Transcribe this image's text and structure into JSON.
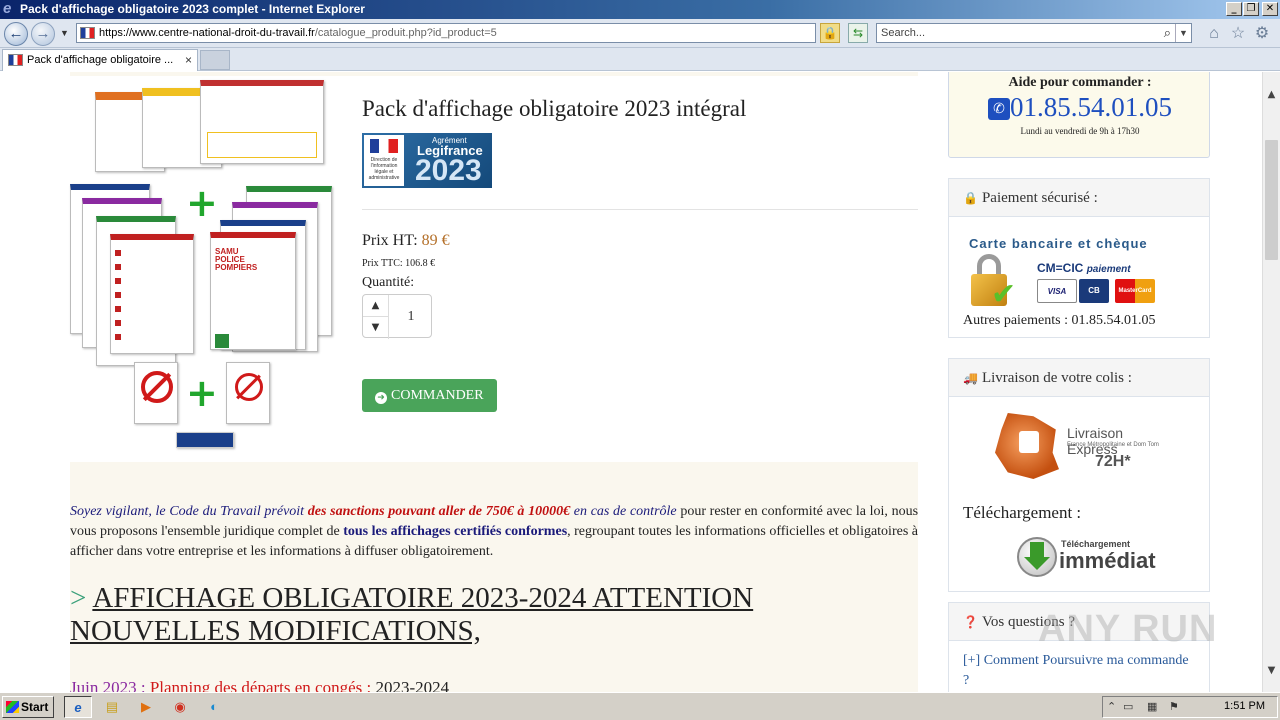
{
  "window": {
    "title": "Pack d'affichage obligatoire 2023 complet - Internet Explorer"
  },
  "address_bar": {
    "url_domain": "https://www.centre-national-droit-du-travail.fr",
    "url_path": "/catalogue_produit.php?id_product=5",
    "search_placeholder": "Search..."
  },
  "tab": {
    "label": "Pack d'affichage obligatoire ...",
    "close": "×"
  },
  "product": {
    "title": "Pack d'affichage obligatoire 2023 intégral",
    "badge": {
      "agrement": "Agrément",
      "brand": "Legifrance",
      "year": "2023",
      "small_text": "Direction de l'information légale et administrative"
    },
    "price_ht_label": "Prix HT:",
    "price_ht_value": "89 €",
    "price_ttc": "Prix TTC: 106.8 €",
    "quantity_label": "Quantité:",
    "quantity_value": "1",
    "order_button": "COMMANDER"
  },
  "description": {
    "p1_italic": "Soyez vigilant, le Code du Travail prévoit",
    "p1_red": "des sanctions pouvant aller de 750€ à 10000€",
    "p1_italic2": "en cas de contrôle",
    "p1_text": "pour rester en conformité avec la loi, nous vous proposons l'ensemble juridique complet de",
    "p1_bold": "tous les affichages certifiés conformes",
    "p1_text2": ", regroupant toutes les informations officielles et obligatoires à afficher dans votre entreprise et les informations à diffuser obligatoirement.",
    "heading_prefix": ">",
    "heading": "AFFICHAGE OBLIGATOIRE 2023-2024 ATTENTION NOUVELLES MODIFICATIONS,",
    "sub_date": "Juin 2023 :",
    "sub_red": "Planning des départs en congés :",
    "sub_text": "2023-2024"
  },
  "sidebar": {
    "help_title": "Aide pour commander :",
    "help_phone": "01.85.54.01.05",
    "help_hours": "Lundi au vendredi de 9h à 17h30",
    "payment_title": "Paiement sécurisé :",
    "payment_cards_title": "Carte bancaire et chèque",
    "payment_cmcic": "CM=CIC",
    "payment_cmcic_sub": "paiement",
    "payment_cards": [
      "VISA",
      "CB",
      "MasterCard"
    ],
    "payment_other": "Autres paiements : 01.85.54.01.05",
    "delivery_title": "Livraison de votre colis :",
    "delivery_logo_title": "Livraison Express",
    "delivery_logo_sub": "France Métropolitaine et Dom Tom",
    "delivery_logo_time": "72H*",
    "download_title": "Téléchargement :",
    "download_logo_small": "Téléchargement",
    "download_logo_big": "immédiat",
    "questions_title": "Vos questions ?",
    "questions_link": "[+] Comment Poursuivre ma commande ?"
  },
  "taskbar": {
    "start_label": "Start",
    "time": "1:51 PM"
  },
  "watermark": "ANY RUN",
  "colors": {
    "accent_green": "#4aa45a",
    "price_orange": "#b4702a",
    "phone_blue": "#1e4fbf",
    "warning_red": "#c01010"
  },
  "icons": [
    "ie-logo",
    "back-arrow-icon",
    "forward-arrow-icon",
    "lock-icon",
    "refresh-icon",
    "search-icon",
    "home-icon",
    "star-icon",
    "gear-icon",
    "phone-icon",
    "truck-icon",
    "question-icon",
    "arrow-circle-icon"
  ]
}
